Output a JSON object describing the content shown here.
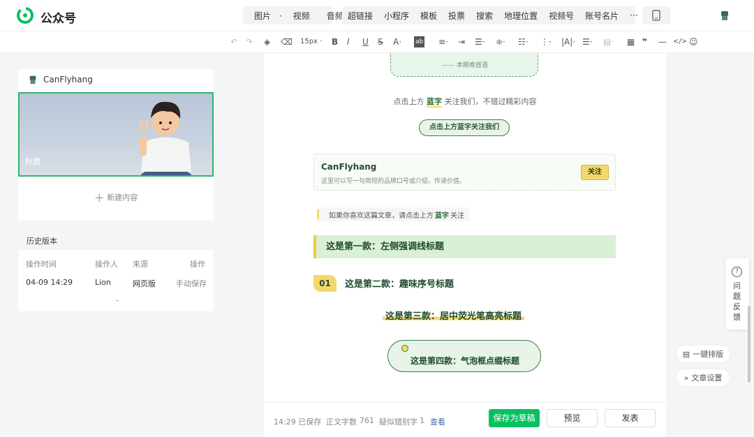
{
  "app": {
    "brand": "公众号"
  },
  "top_menu": {
    "group1": [
      "图片",
      "视频",
      "音频"
    ],
    "group2": [
      "超链接",
      "小程序",
      "模板",
      "投票",
      "搜索",
      "地理位置",
      "视频号",
      "账号名片",
      "···"
    ]
  },
  "toolbar": {
    "font_size": "15px"
  },
  "account": {
    "name": "CanFlyhang",
    "cover_title": "标题",
    "new_content": "新建内容"
  },
  "history": {
    "label": "历史版本",
    "columns": [
      "操作时间",
      "操作人",
      "来源",
      "操作"
    ],
    "row": {
      "time": "04-09 14:29",
      "operator": "Lion",
      "source": "网页版",
      "action": "手动保存"
    }
  },
  "editor": {
    "quote_caption": "—— 本期卷首语",
    "follow_line_pre": "点击上方",
    "follow_line_bold": "蓝字",
    "follow_line_post": "关注我们，不错过精彩内容",
    "follow_pill": "点击上方蓝字关注我们",
    "brand_card": {
      "name": "CanFlyhang",
      "desc": "这里可以写一句简短的品牌口号或介绍，传递价值。",
      "follow": "关注"
    },
    "like_line_pre": "如果你喜欢这篇文章，请点击上方",
    "like_line_bold": "蓝字",
    "like_line_post": "关注",
    "heading1": "这是第一款：左侧强调线标题",
    "heading2_num": "01",
    "heading2": "这是第二款：趣味序号标题",
    "heading3": "这是第三款：居中荧光笔高亮标题",
    "heading4": "这是第四款：气泡框点缀标题"
  },
  "footer": {
    "saved": "14:29 已保存",
    "word_count_label": "正文字数",
    "word_count": "761",
    "typo_label": "疑似错别字",
    "typo_count": "1",
    "view": "查看",
    "save_draft": "保存为草稿",
    "preview": "预览",
    "publish": "发表"
  },
  "side": {
    "feedback": "问题反馈",
    "one_click": "一键排版",
    "article_settings": "文章设置"
  },
  "colors": {
    "accent_green": "#07c160",
    "heading_green": "#1f4a2c",
    "highlight_yellow": "#f5d86b"
  }
}
